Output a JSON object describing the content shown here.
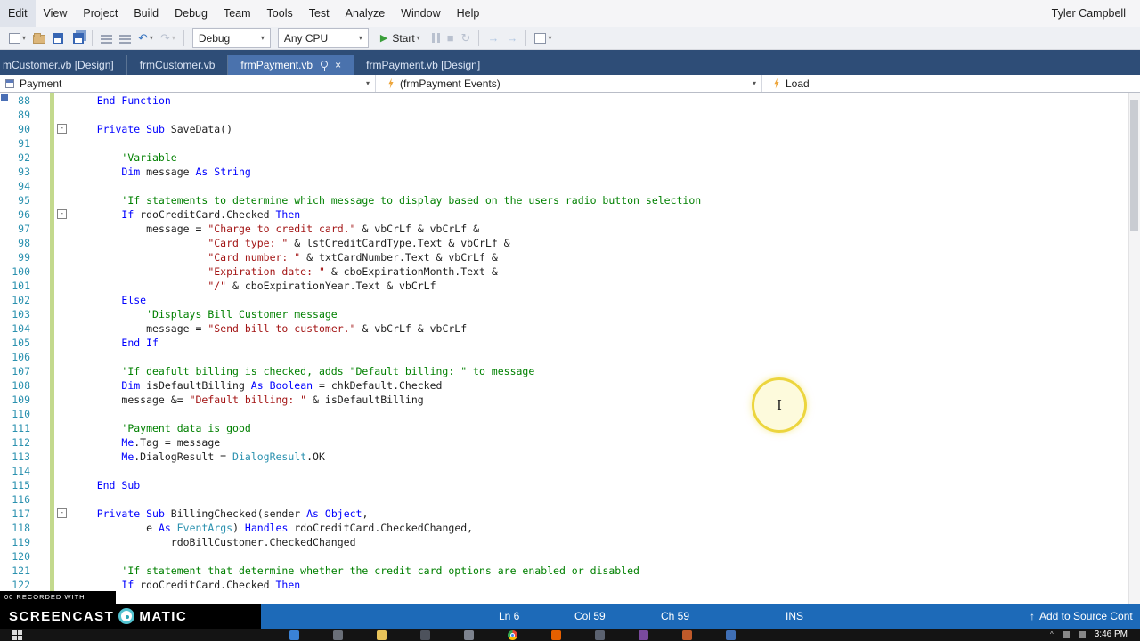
{
  "window": {
    "user": "Tyler Campbell"
  },
  "menu": {
    "items": [
      "Edit",
      "View",
      "Project",
      "Build",
      "Debug",
      "Team",
      "Tools",
      "Test",
      "Analyze",
      "Window",
      "Help"
    ]
  },
  "toolbar": {
    "debug_config": "Debug",
    "platform": "Any CPU",
    "start_label": "Start",
    "icons": [
      "add-item-icon",
      "open-folder-icon",
      "save-icon",
      "save-all-icon",
      "comment-icon",
      "uncomment-icon",
      "undo-icon",
      "redo-icon",
      "pause-icon",
      "stop-icon",
      "restart-icon",
      "step-into-icon",
      "step-over-icon",
      "step-out-icon",
      "more-tools-icon"
    ]
  },
  "tabs": [
    {
      "label": "mCustomer.vb [Design]",
      "active": false
    },
    {
      "label": "frmCustomer.vb",
      "active": false
    },
    {
      "label": "frmPayment.vb",
      "active": true
    },
    {
      "label": "frmPayment.vb [Design]",
      "active": false
    }
  ],
  "navbar": {
    "class_name": "Payment",
    "member_name": "(frmPayment Events)",
    "event_name": "Load"
  },
  "editor": {
    "lines": [
      {
        "n": 88,
        "ind": 4,
        "t": [
          [
            "k",
            "End Function"
          ]
        ]
      },
      {
        "n": 89,
        "ind": 0,
        "t": []
      },
      {
        "n": 90,
        "fold": "-",
        "ind": 4,
        "t": [
          [
            "k",
            "Private Sub"
          ],
          [
            "p",
            " SaveData()"
          ]
        ]
      },
      {
        "n": 91,
        "ind": 0,
        "t": []
      },
      {
        "n": 92,
        "ind": 8,
        "t": [
          [
            "c",
            "'Variable"
          ]
        ]
      },
      {
        "n": 93,
        "ind": 8,
        "t": [
          [
            "k",
            "Dim"
          ],
          [
            "p",
            " message "
          ],
          [
            "k",
            "As"
          ],
          [
            "p",
            " "
          ],
          [
            "k",
            "String"
          ]
        ]
      },
      {
        "n": 94,
        "ind": 0,
        "t": []
      },
      {
        "n": 95,
        "ind": 8,
        "t": [
          [
            "c",
            "'If statements to determine which message to display based on the users radio button selection"
          ]
        ]
      },
      {
        "n": 96,
        "fold": "-",
        "ind": 8,
        "t": [
          [
            "k",
            "If"
          ],
          [
            "p",
            " rdoCreditCard.Checked "
          ],
          [
            "k",
            "Then"
          ]
        ]
      },
      {
        "n": 97,
        "ind": 12,
        "t": [
          [
            "p",
            "message = "
          ],
          [
            "s",
            "\"Charge to credit card.\""
          ],
          [
            "p",
            " & vbCrLf & vbCrLf &"
          ]
        ]
      },
      {
        "n": 98,
        "ind": 22,
        "t": [
          [
            "s",
            "\"Card type: \""
          ],
          [
            "p",
            " & lstCreditCardType.Text & vbCrLf &"
          ]
        ]
      },
      {
        "n": 99,
        "ind": 22,
        "t": [
          [
            "s",
            "\"Card number: \""
          ],
          [
            "p",
            " & txtCardNumber.Text & vbCrLf &"
          ]
        ]
      },
      {
        "n": 100,
        "ind": 22,
        "t": [
          [
            "s",
            "\"Expiration date: \""
          ],
          [
            "p",
            " & cboExpirationMonth.Text &"
          ]
        ]
      },
      {
        "n": 101,
        "ind": 22,
        "t": [
          [
            "s",
            "\"/\""
          ],
          [
            "p",
            " & cboExpirationYear.Text & vbCrLf"
          ]
        ]
      },
      {
        "n": 102,
        "ind": 8,
        "t": [
          [
            "k",
            "Else"
          ]
        ]
      },
      {
        "n": 103,
        "ind": 12,
        "t": [
          [
            "c",
            "'Displays Bill Customer message"
          ]
        ]
      },
      {
        "n": 104,
        "ind": 12,
        "t": [
          [
            "p",
            "message = "
          ],
          [
            "s",
            "\"Send bill to customer.\""
          ],
          [
            "p",
            " & vbCrLf & vbCrLf"
          ]
        ]
      },
      {
        "n": 105,
        "ind": 8,
        "t": [
          [
            "k",
            "End If"
          ]
        ]
      },
      {
        "n": 106,
        "ind": 0,
        "t": []
      },
      {
        "n": 107,
        "ind": 8,
        "t": [
          [
            "c",
            "'If deafult billing is checked, adds \"Default billing: \" to message"
          ]
        ]
      },
      {
        "n": 108,
        "ind": 8,
        "t": [
          [
            "k",
            "Dim"
          ],
          [
            "p",
            " isDefaultBilling "
          ],
          [
            "k",
            "As"
          ],
          [
            "p",
            " "
          ],
          [
            "k",
            "Boolean"
          ],
          [
            "p",
            " = chkDefault.Checked"
          ]
        ]
      },
      {
        "n": 109,
        "ind": 8,
        "t": [
          [
            "p",
            "message &= "
          ],
          [
            "s",
            "\"Default billing: \""
          ],
          [
            "p",
            " & isDefaultBilling"
          ]
        ]
      },
      {
        "n": 110,
        "ind": 0,
        "t": []
      },
      {
        "n": 111,
        "ind": 8,
        "t": [
          [
            "c",
            "'Payment data is good"
          ]
        ]
      },
      {
        "n": 112,
        "ind": 8,
        "t": [
          [
            "k",
            "Me"
          ],
          [
            "p",
            ".Tag = message"
          ]
        ]
      },
      {
        "n": 113,
        "ind": 8,
        "t": [
          [
            "k",
            "Me"
          ],
          [
            "p",
            ".DialogResult = "
          ],
          [
            "t",
            "DialogResult"
          ],
          [
            "p",
            ".OK"
          ]
        ]
      },
      {
        "n": 114,
        "ind": 0,
        "t": []
      },
      {
        "n": 115,
        "ind": 4,
        "t": [
          [
            "k",
            "End Sub"
          ]
        ]
      },
      {
        "n": 116,
        "ind": 0,
        "t": []
      },
      {
        "n": 117,
        "fold": "-",
        "ind": 4,
        "t": [
          [
            "k",
            "Private Sub"
          ],
          [
            "p",
            " BillingChecked(sender "
          ],
          [
            "k",
            "As"
          ],
          [
            "p",
            " "
          ],
          [
            "k",
            "Object"
          ],
          [
            "p",
            ","
          ]
        ]
      },
      {
        "n": 118,
        "ind": 12,
        "t": [
          [
            "p",
            "e "
          ],
          [
            "k",
            "As"
          ],
          [
            "p",
            " "
          ],
          [
            "t",
            "EventArgs"
          ],
          [
            "p",
            ") "
          ],
          [
            "k",
            "Handles"
          ],
          [
            "p",
            " rdoCreditCard.CheckedChanged,"
          ]
        ]
      },
      {
        "n": 119,
        "ind": 16,
        "t": [
          [
            "p",
            "rdoBillCustomer.CheckedChanged"
          ]
        ]
      },
      {
        "n": 120,
        "ind": 0,
        "t": []
      },
      {
        "n": 121,
        "ind": 8,
        "t": [
          [
            "c",
            "'If statement that determine whether the credit card options are enabled or disabled"
          ]
        ]
      },
      {
        "n": 122,
        "ind": 8,
        "t": [
          [
            "k",
            "If"
          ],
          [
            "p",
            " rdoCreditCard.Checked "
          ],
          [
            "k",
            "Then"
          ]
        ]
      }
    ]
  },
  "statusbar": {
    "line": "Ln 6",
    "column": "Col 59",
    "character": "Ch 59",
    "mode": "INS",
    "source_control": "Add to Source Cont"
  },
  "watermark": {
    "recorded_with": "00 RECORDED WITH",
    "brand_left": "SCREENCAST",
    "brand_right": "MATIC"
  },
  "taskbar": {
    "time": "3:46 PM",
    "icons": [
      {
        "name": "edge-icon",
        "color": "#3a82d6"
      },
      {
        "name": "app-gray-icon",
        "color": "#6a6f78"
      },
      {
        "name": "file-explorer-icon",
        "color": "#e8c35a"
      },
      {
        "name": "app-dark-icon",
        "color": "#4d525c"
      },
      {
        "name": "app-steel-icon",
        "color": "#7d838e"
      },
      {
        "name": "chrome-icon",
        "color": "conic"
      },
      {
        "name": "firefox-icon",
        "color": "#e66000"
      },
      {
        "name": "app-slate-icon",
        "color": "#5b6270"
      },
      {
        "name": "visual-studio-icon",
        "color": "#7a4a9e"
      },
      {
        "name": "app-orange-icon",
        "color": "#c05a2a"
      },
      {
        "name": "app-blue-icon",
        "color": "#3f6fb5"
      }
    ]
  },
  "colors": {
    "keyword": "#0000ff",
    "comment": "#008000",
    "string": "#a31515",
    "type": "#2b91af",
    "line_number": "#2b91af",
    "tab_strip": "#2e4d77",
    "tab_active": "#4a72ad",
    "status_bar": "#1d6ab8",
    "change_bar": "#c3d98d",
    "click_highlight": "#ecd53e"
  }
}
